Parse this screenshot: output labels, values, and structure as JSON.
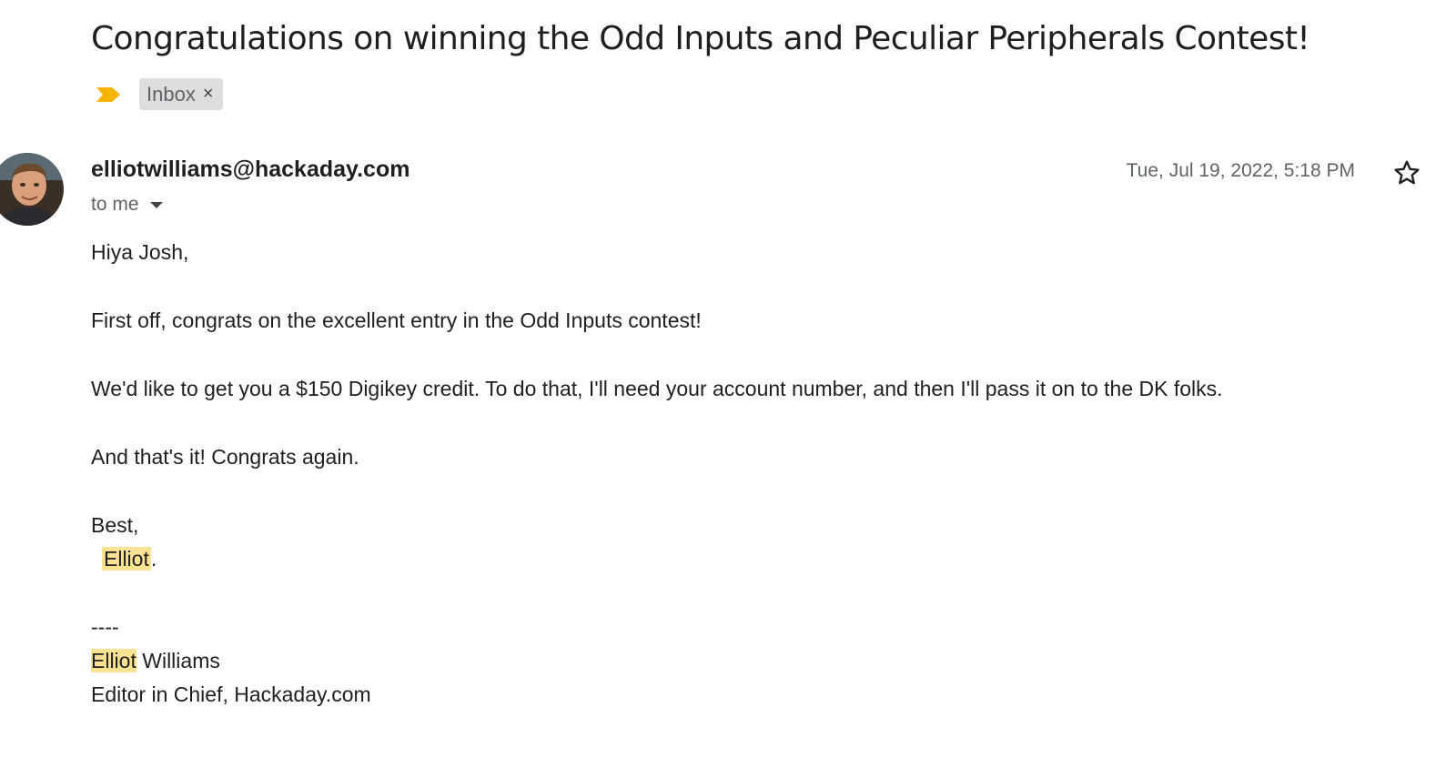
{
  "email": {
    "subject": "Congratulations on winning the Odd Inputs and Peculiar Peripherals Contest!",
    "label": "Inbox",
    "label_remove": "×",
    "sender": "elliotwilliams@hackaday.com",
    "recipient": "to me",
    "date": "Tue, Jul 19, 2022, 5:18 PM",
    "greeting": "Hiya Josh,",
    "paragraph1": "First off, congrats on the excellent entry in the Odd Inputs contest!",
    "paragraph2": "We'd like to get you a $150 Digikey credit.  To do that, I'll need your account number, and then I'll pass it on to the DK folks.",
    "paragraph3": "And that's it!  Congrats again.",
    "closing": "Best,",
    "signoff_name": "Elliot",
    "signoff_punct": ".",
    "sig_separator": "----",
    "sig_first": "Elliot",
    "sig_last": " Williams",
    "sig_title": "Editor in Chief, Hackaday.com"
  },
  "colors": {
    "importance": "#f4b400",
    "highlight": "#fde293"
  },
  "icons": {
    "importance": "importance-marker-icon",
    "dropdown": "caret-down-icon",
    "star": "star-outline-icon"
  }
}
